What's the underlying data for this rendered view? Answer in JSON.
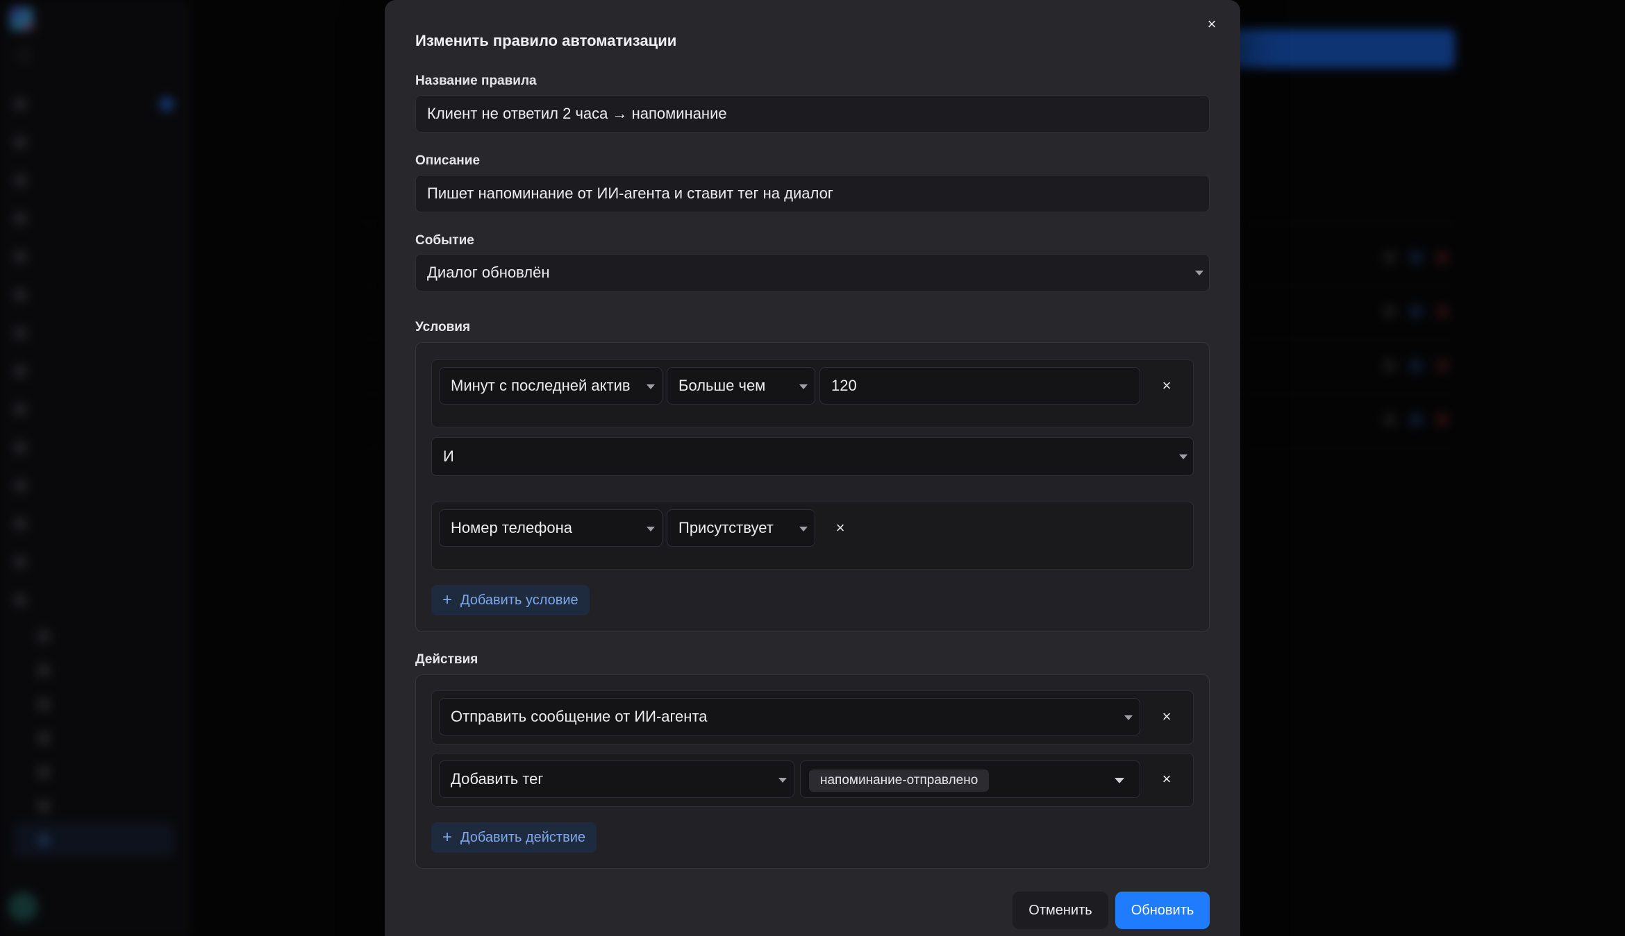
{
  "modal": {
    "title": "Изменить правило автоматизации",
    "close_icon": "×",
    "rule_name_label": "Название правила",
    "rule_name_value": "Клиент не ответил 2 часа → напоминание",
    "description_label": "Описание",
    "description_value": "Пишет напоминание от ИИ-агента и ставит тег на диалог",
    "event_label": "Событие",
    "event_value": "Диалог обновлён",
    "conditions_label": "Условия",
    "conditions": [
      {
        "field": "Минут с последней актив",
        "operator": "Больше чем",
        "value": "120"
      },
      {
        "field": "Номер телефона",
        "operator": "Присутствует",
        "value": ""
      }
    ],
    "condition_logic": "И",
    "add_condition_label": "Добавить условие",
    "actions_label": "Действия",
    "actions": [
      {
        "type": "Отправить сообщение от ИИ-агента"
      },
      {
        "type": "Добавить тег",
        "tag": "напоминание-отправлено"
      }
    ],
    "add_action_label": "Добавить действие",
    "cancel_label": "Отменить",
    "submit_label": "Обновить",
    "remove_icon": "×",
    "plus_icon": "+"
  },
  "colors": {
    "accent": "#1f7cff",
    "modal_bg": "#27272c",
    "field_bg": "#1c1c20",
    "add_button_text": "#7ea8ea"
  },
  "icons": {
    "close": "close-icon",
    "remove": "close-icon",
    "add": "plus-icon",
    "dropdown": "chevron-down-icon"
  }
}
